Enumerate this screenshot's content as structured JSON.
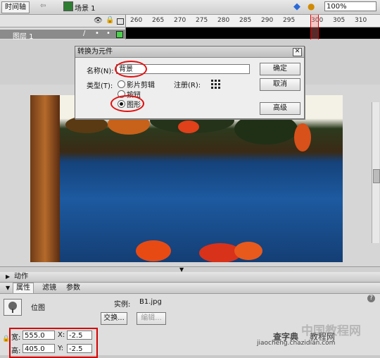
{
  "toolbar": {
    "timeline_label": "时间轴",
    "scene_label": "场景 1",
    "zoom_value": "100%"
  },
  "timeline": {
    "ruler_ticks": [
      "260",
      "265",
      "270",
      "275",
      "280",
      "285",
      "290",
      "295",
      "300",
      "305",
      "310"
    ],
    "layer_name": "图层 1"
  },
  "dialog": {
    "title": "转换为元件",
    "name_label": "名称(N):",
    "name_value": "背景",
    "type_label": "类型(T):",
    "options": [
      "影片剪辑",
      "按钮",
      "图形"
    ],
    "selected": "图形",
    "registration_label": "注册(R):",
    "ok_label": "确定",
    "cancel_label": "取消",
    "advanced_label": "高级"
  },
  "panels": {
    "actions_label": "动作",
    "tabs": [
      "属性",
      "滤镜",
      "参数"
    ],
    "bitmap_label": "位图",
    "instance_label": "实例:",
    "instance_value": "B1.jpg",
    "swap_label": "交换...",
    "edit_label": "编辑...",
    "width_label": "宽:",
    "width_value": "555.0",
    "height_label": "高:",
    "height_value": "405.0",
    "x_label": "X:",
    "x_value": "-2.5",
    "y_label": "Y:",
    "y_value": "-2.5"
  },
  "watermark": {
    "cn": "中国教程网",
    "site_cn": "查字典",
    "site_cn2": "教程网",
    "url": "jiaocheng.chazidian.com"
  },
  "colors": {
    "highlight_red": "#e01010",
    "playhead_red": "#d00000"
  }
}
